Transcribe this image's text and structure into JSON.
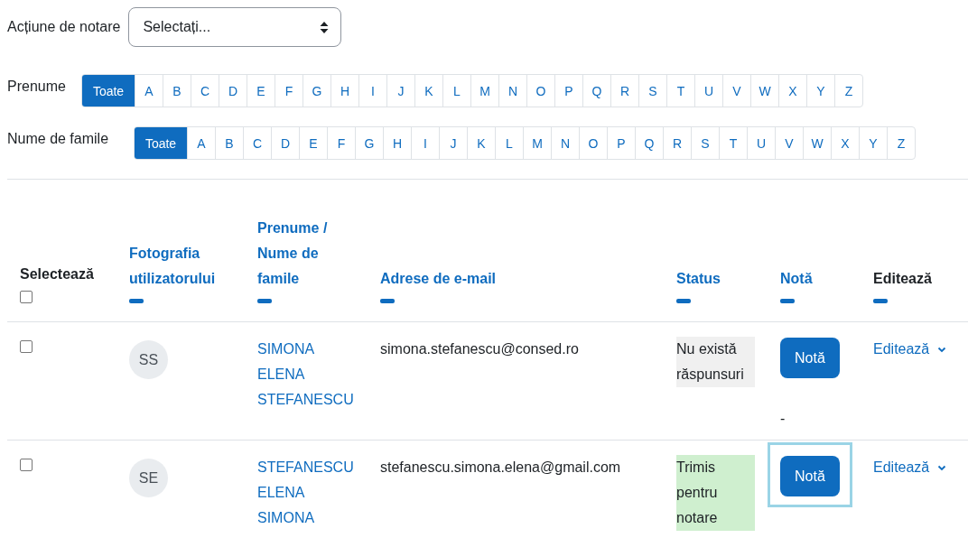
{
  "grading_action": {
    "label": "Acțiune de notare",
    "value": "Selectați..."
  },
  "filters": [
    {
      "label": "Prenume",
      "options": [
        {
          "label": "Toate",
          "selected": true
        },
        {
          "label": "A",
          "selected": false
        },
        {
          "label": "B",
          "selected": false
        },
        {
          "label": "C",
          "selected": false
        },
        {
          "label": "D",
          "selected": false
        },
        {
          "label": "E",
          "selected": false
        },
        {
          "label": "F",
          "selected": false
        },
        {
          "label": "G",
          "selected": false
        },
        {
          "label": "H",
          "selected": false
        },
        {
          "label": "I",
          "selected": false
        },
        {
          "label": "J",
          "selected": false
        },
        {
          "label": "K",
          "selected": false
        },
        {
          "label": "L",
          "selected": false
        },
        {
          "label": "M",
          "selected": false
        },
        {
          "label": "N",
          "selected": false
        },
        {
          "label": "O",
          "selected": false
        },
        {
          "label": "P",
          "selected": false
        },
        {
          "label": "Q",
          "selected": false
        },
        {
          "label": "R",
          "selected": false
        },
        {
          "label": "S",
          "selected": false
        },
        {
          "label": "T",
          "selected": false
        },
        {
          "label": "U",
          "selected": false
        },
        {
          "label": "V",
          "selected": false
        },
        {
          "label": "W",
          "selected": false
        },
        {
          "label": "X",
          "selected": false
        },
        {
          "label": "Y",
          "selected": false
        },
        {
          "label": "Z",
          "selected": false
        }
      ]
    },
    {
      "label": "Nume de famile",
      "options": [
        {
          "label": "Toate",
          "selected": true
        },
        {
          "label": "A",
          "selected": false
        },
        {
          "label": "B",
          "selected": false
        },
        {
          "label": "C",
          "selected": false
        },
        {
          "label": "D",
          "selected": false
        },
        {
          "label": "E",
          "selected": false
        },
        {
          "label": "F",
          "selected": false
        },
        {
          "label": "G",
          "selected": false
        },
        {
          "label": "H",
          "selected": false
        },
        {
          "label": "I",
          "selected": false
        },
        {
          "label": "J",
          "selected": false
        },
        {
          "label": "K",
          "selected": false
        },
        {
          "label": "L",
          "selected": false
        },
        {
          "label": "M",
          "selected": false
        },
        {
          "label": "N",
          "selected": false
        },
        {
          "label": "O",
          "selected": false
        },
        {
          "label": "P",
          "selected": false
        },
        {
          "label": "Q",
          "selected": false
        },
        {
          "label": "R",
          "selected": false
        },
        {
          "label": "S",
          "selected": false
        },
        {
          "label": "T",
          "selected": false
        },
        {
          "label": "U",
          "selected": false
        },
        {
          "label": "V",
          "selected": false
        },
        {
          "label": "W",
          "selected": false
        },
        {
          "label": "X",
          "selected": false
        },
        {
          "label": "Y",
          "selected": false
        },
        {
          "label": "Z",
          "selected": false
        }
      ]
    }
  ],
  "table": {
    "columns": [
      {
        "label": "Selectează",
        "kind": "checkbox",
        "checked": false
      },
      {
        "label": "Fotografia utilizatorului",
        "kind": "link"
      },
      {
        "label": "Prenume / Nume de famile",
        "kind": "link"
      },
      {
        "label": "Adrese de e-mail",
        "kind": "link"
      },
      {
        "label": "Status",
        "kind": "link"
      },
      {
        "label": "Notă",
        "kind": "link"
      },
      {
        "label": "Editează",
        "kind": "plain"
      }
    ],
    "rows": [
      {
        "checked": false,
        "initials": "SS",
        "name": "SIMONA ELENA STEFANESCU",
        "email": "simona.stefanescu@consed.ro",
        "status": {
          "text": "Nu există răspunsuri",
          "color": "#f0f0f0"
        },
        "grade_button": "Notă",
        "grade_focused": false,
        "grade": "-",
        "edit": "Editează"
      },
      {
        "checked": false,
        "initials": "SE",
        "name": "STEFANESCU ELENA SIMONA",
        "email": "stefanescu.simona.elena@gmail.com",
        "status": {
          "text": "Trimis pentru notare",
          "color": "#cfefcf"
        },
        "grade_button": "Notă",
        "grade_focused": true,
        "edit": "Editează"
      }
    ]
  }
}
